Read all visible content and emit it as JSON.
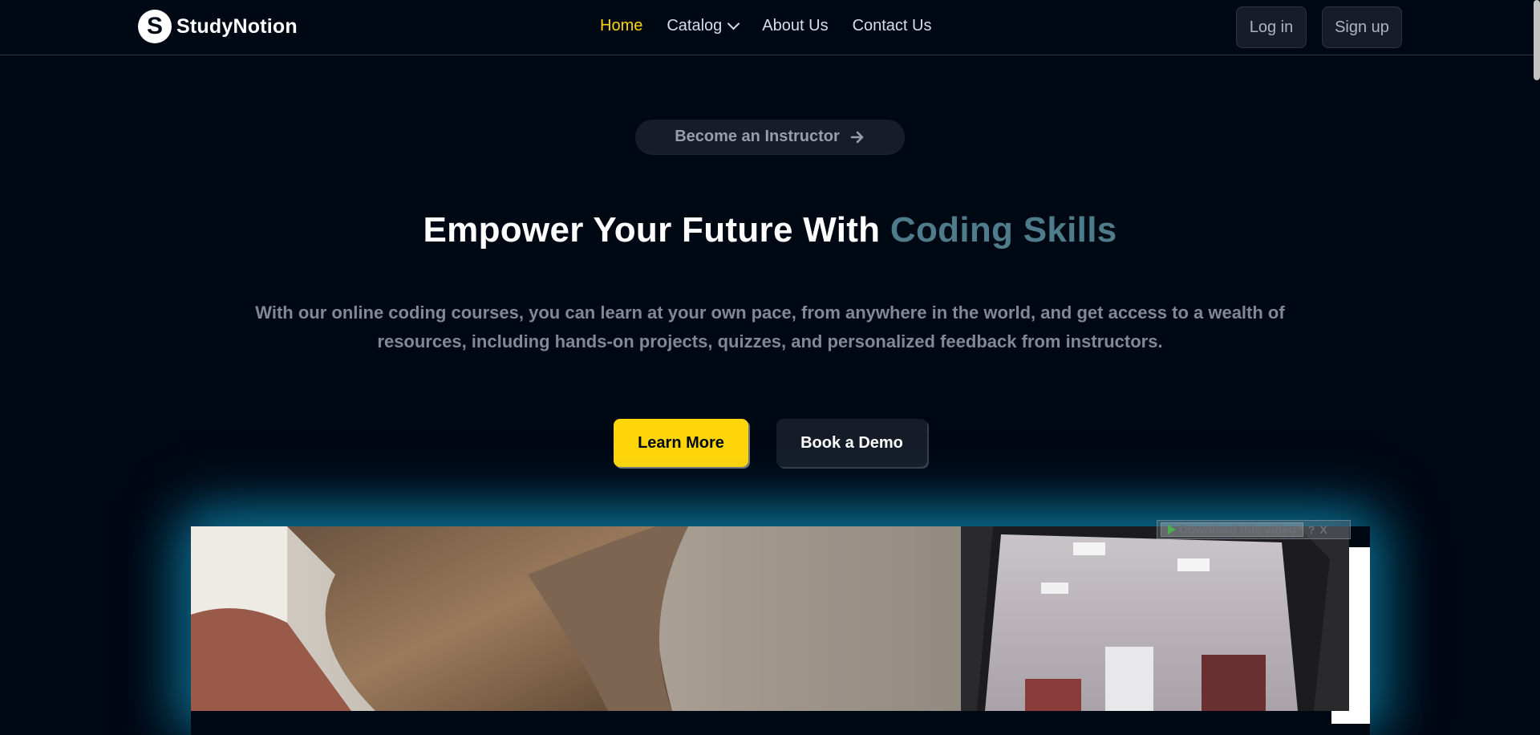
{
  "brand": {
    "name": "StudyNotion",
    "logo_letter": "S"
  },
  "nav": {
    "links": [
      {
        "label": "Home",
        "active": true
      },
      {
        "label": "Catalog",
        "active": false
      },
      {
        "label": "About Us",
        "active": false
      },
      {
        "label": "Contact Us",
        "active": false
      }
    ],
    "login_label": "Log in",
    "signup_label": "Sign up"
  },
  "hero": {
    "instructor_cta": "Become an Instructor",
    "title_main": "Empower Your Future With ",
    "title_highlight": "Coding Skills",
    "subtitle": "With our online coding courses, you can learn at your own pace, from anywhere in the world, and get access to a wealth of resources, including hands-on projects, quizzes, and personalized feedback from instructors.",
    "learn_more_label": "Learn More",
    "book_demo_label": "Book a Demo"
  },
  "video_overlay": {
    "download_label": "Download this video",
    "help_label": "?",
    "close_label": "X"
  },
  "colors": {
    "background": "#000814",
    "accent_yellow": "#ffd60a",
    "highlight": "#4f7c8b",
    "glow": "#118ab2"
  },
  "icons": [
    "chevron-down-icon",
    "arrow-right-icon",
    "play-icon"
  ]
}
